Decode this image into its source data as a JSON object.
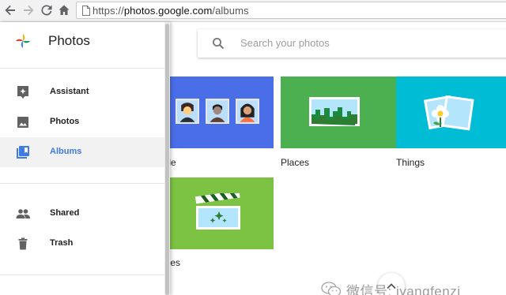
{
  "browser": {
    "url_scheme": "https://",
    "url_host": "photos.google.com",
    "url_path": "/albums",
    "icons": [
      "back-arrow-icon",
      "forward-arrow-icon",
      "reload-icon",
      "home-icon",
      "document-icon"
    ]
  },
  "search": {
    "placeholder": "Search your photos",
    "icon": "search-icon"
  },
  "drawer": {
    "title": "Photos",
    "logo": "google-photos-pinwheel-icon",
    "items": [
      {
        "label": "Assistant",
        "icon": "assistant-icon",
        "active": false
      },
      {
        "label": "Photos",
        "icon": "photo-icon",
        "active": false
      },
      {
        "label": "Albums",
        "icon": "albums-icon",
        "active": true
      },
      {
        "label": "Shared",
        "icon": "people-icon",
        "active": false
      },
      {
        "label": "Trash",
        "icon": "trash-icon",
        "active": false
      }
    ]
  },
  "albums": [
    {
      "label": "ople",
      "color": "#4a6ee8"
    },
    {
      "label": "Places",
      "color": "#4caf50"
    },
    {
      "label": "Things",
      "color": "#00bcd4"
    },
    {
      "label": "ovies",
      "color": "#7cc243"
    }
  ],
  "watermark": {
    "text": "微信号: iyangfenzi",
    "icon": "wechat-icon"
  },
  "colors": {
    "accent": "#3e7be6",
    "active_bg": "#f2f2f2"
  }
}
